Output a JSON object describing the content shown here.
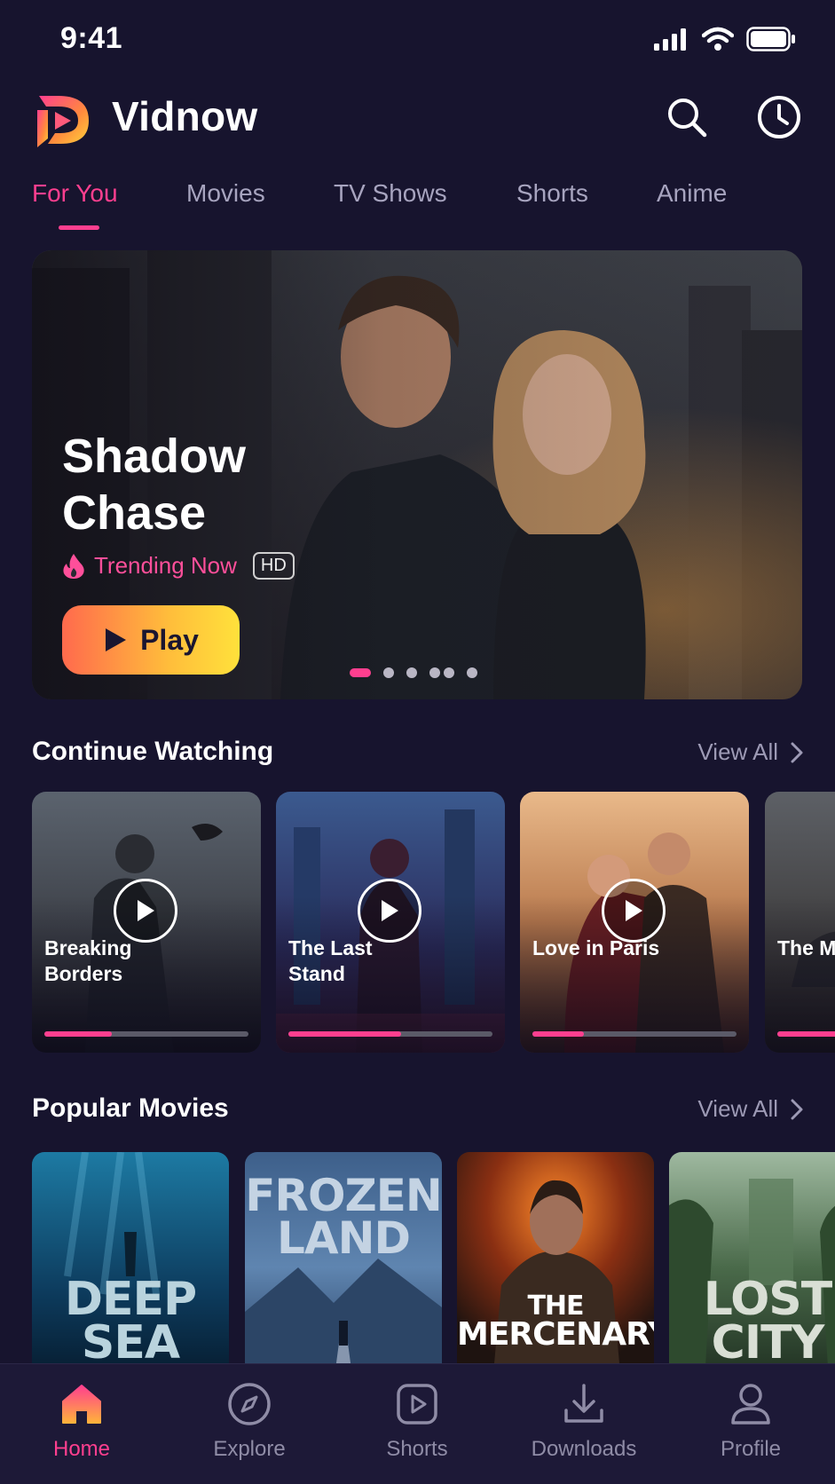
{
  "status_bar": {
    "time": "9:41"
  },
  "header": {
    "app_title": "Vidnow",
    "icons": [
      "search-icon",
      "history-clock-icon"
    ]
  },
  "tabs": [
    {
      "label": "For You",
      "active": true
    },
    {
      "label": "Movies",
      "active": false
    },
    {
      "label": "TV Shows",
      "active": false
    },
    {
      "label": "Shorts",
      "active": false
    },
    {
      "label": "Anime",
      "active": false
    }
  ],
  "hero": {
    "title": "Shadow Chase",
    "trending_label": "Trending Now",
    "quality_badge": "HD",
    "play_label": "Play",
    "slide_count": 6,
    "active_slide": 0
  },
  "continue_watching": {
    "title": "Continue Watching",
    "view_all": "View All",
    "items": [
      {
        "title": "Breaking Borders",
        "progress": 0.33
      },
      {
        "title": "The Last Stand",
        "progress": 0.55
      },
      {
        "title": "Love in Paris",
        "progress": 0.25
      },
      {
        "title": "The M Return",
        "progress": 0.5
      }
    ]
  },
  "popular_movies": {
    "title": "Popular Movies",
    "view_all": "View All",
    "items": [
      {
        "title_line1": "DEEP",
        "title_line2": "SEA"
      },
      {
        "title_line1": "FROZEN",
        "title_line2": "LAND"
      },
      {
        "title_line1": "THE",
        "title_line2": "MERCENARY"
      },
      {
        "title_line1": "LOST",
        "title_line2": "CITY"
      }
    ]
  },
  "bottom_nav": [
    {
      "label": "Home",
      "icon": "home-icon",
      "active": true
    },
    {
      "label": "Explore",
      "icon": "compass-icon",
      "active": false
    },
    {
      "label": "Shorts",
      "icon": "play-square-icon",
      "active": false
    },
    {
      "label": "Downloads",
      "icon": "download-icon",
      "active": false
    },
    {
      "label": "Profile",
      "icon": "user-icon",
      "active": false
    }
  ],
  "colors": {
    "background": "#17142e",
    "accent": "#ff3f8f",
    "play_gradient_start": "#ff6a4d",
    "play_gradient_end": "#ffe13b"
  }
}
